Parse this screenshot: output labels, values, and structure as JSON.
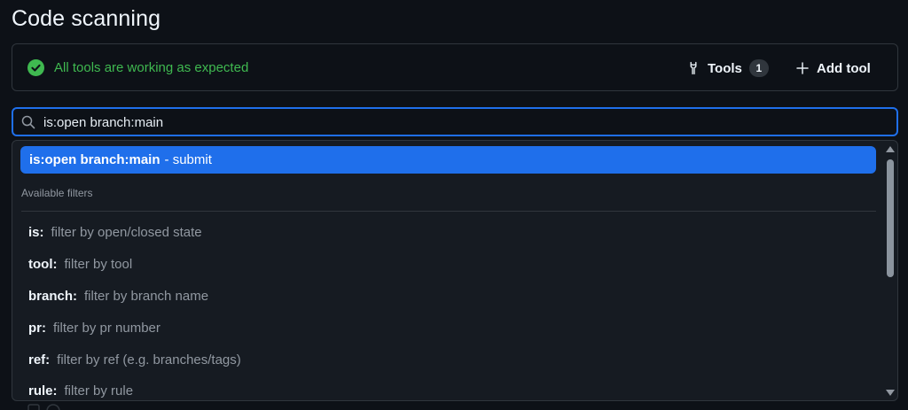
{
  "page": {
    "title": "Code scanning"
  },
  "status": {
    "message": "All tools are working as expected",
    "icon": "check-circle-fill-icon",
    "color": "#3fb950"
  },
  "tools": {
    "label": "Tools",
    "count": "1",
    "icon": "tools-icon"
  },
  "add_tool": {
    "label": "Add tool",
    "icon": "plus-icon"
  },
  "search": {
    "value": "is:open branch:main",
    "icon": "search-icon",
    "accent": "#1f6feb"
  },
  "dropdown": {
    "suggestion": {
      "query": "is:open branch:main",
      "suffix": "- submit"
    },
    "section_label": "Available filters",
    "filters": [
      {
        "key": "is:",
        "desc": "filter by open/closed state"
      },
      {
        "key": "tool:",
        "desc": "filter by tool"
      },
      {
        "key": "branch:",
        "desc": "filter by branch name"
      },
      {
        "key": "pr:",
        "desc": "filter by pr number"
      },
      {
        "key": "ref:",
        "desc": "filter by ref (e.g. branches/tags)"
      },
      {
        "key": "rule:",
        "desc": "filter by rule"
      }
    ]
  }
}
